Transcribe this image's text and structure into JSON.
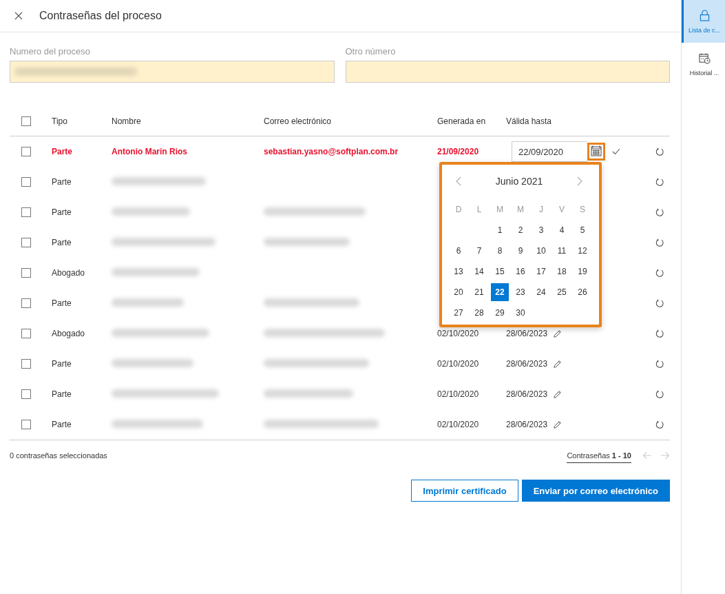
{
  "dialog": {
    "title": "Contraseñas del proceso"
  },
  "fields": [
    {
      "label": "Numero del proceso",
      "blurred": true
    },
    {
      "label": "Otro número",
      "blurred": false
    }
  ],
  "table": {
    "columns": [
      "Tipo",
      "Nombre",
      "Correo electrónico",
      "Generada en",
      "Válida hasta"
    ],
    "all_checked": false,
    "rows": [
      {
        "checked": false,
        "highlighted": true,
        "type": "Parte",
        "name": "Antonio Marin Rios",
        "email": "sebastian.yasno@softplan.com.br",
        "generated": "21/09/2020",
        "valid_until": "22/09/2020",
        "editing": true
      },
      {
        "checked": false,
        "highlighted": false,
        "type": "Parte",
        "name_blurred": true,
        "email_blurred": false
      },
      {
        "checked": false,
        "highlighted": false,
        "type": "Parte",
        "name_blurred": true,
        "email_blurred": true
      },
      {
        "checked": false,
        "highlighted": false,
        "type": "Parte",
        "name_blurred": true,
        "email_blurred": true
      },
      {
        "checked": false,
        "highlighted": false,
        "type": "Abogado",
        "name_blurred": true,
        "email_blurred": false
      },
      {
        "checked": false,
        "highlighted": false,
        "type": "Parte",
        "name_blurred": true,
        "email_blurred": true
      },
      {
        "checked": false,
        "highlighted": false,
        "type": "Abogado",
        "name_blurred": true,
        "email_blurred": true,
        "generated": "02/10/2020",
        "valid_until": "28/06/2023",
        "editing": false
      },
      {
        "checked": false,
        "highlighted": false,
        "type": "Parte",
        "name_blurred": true,
        "email_blurred": true,
        "generated": "02/10/2020",
        "valid_until": "28/06/2023",
        "editing": false
      },
      {
        "checked": false,
        "highlighted": false,
        "type": "Parte",
        "name_blurred": true,
        "email_blurred": true,
        "generated": "02/10/2020",
        "valid_until": "28/06/2023",
        "editing": false
      },
      {
        "checked": false,
        "highlighted": false,
        "type": "Parte",
        "name_blurred": true,
        "email_blurred": true,
        "generated": "02/10/2020",
        "valid_until": "28/06/2023",
        "editing": false
      }
    ]
  },
  "calendar": {
    "month": "Junio 2021",
    "weekdays": [
      "D",
      "L",
      "M",
      "M",
      "J",
      "V",
      "S"
    ],
    "weeks": [
      [
        {
          "kind": "empty"
        },
        {
          "kind": "empty"
        },
        {
          "label": "1",
          "selected": false
        },
        {
          "label": "2",
          "selected": false
        },
        {
          "label": "3",
          "selected": false
        },
        {
          "label": "4",
          "selected": false
        },
        {
          "label": "5",
          "selected": false
        }
      ],
      [
        {
          "label": "6",
          "selected": false
        },
        {
          "label": "7",
          "selected": false
        },
        {
          "label": "8",
          "selected": false
        },
        {
          "label": "9",
          "selected": false
        },
        {
          "label": "10",
          "selected": false
        },
        {
          "label": "11",
          "selected": false
        },
        {
          "label": "12",
          "selected": false
        }
      ],
      [
        {
          "label": "13",
          "selected": false
        },
        {
          "label": "14",
          "selected": false
        },
        {
          "label": "15",
          "selected": false
        },
        {
          "label": "16",
          "selected": false
        },
        {
          "label": "17",
          "selected": false
        },
        {
          "label": "18",
          "selected": false
        },
        {
          "label": "19",
          "selected": false
        }
      ],
      [
        {
          "label": "20",
          "selected": false
        },
        {
          "label": "21",
          "selected": false
        },
        {
          "label": "22",
          "selected": true
        },
        {
          "label": "23",
          "selected": false
        },
        {
          "label": "24",
          "selected": false
        },
        {
          "label": "25",
          "selected": false
        },
        {
          "label": "26",
          "selected": false
        }
      ],
      [
        {
          "label": "27",
          "selected": false
        },
        {
          "label": "28",
          "selected": false
        },
        {
          "label": "29",
          "selected": false
        },
        {
          "label": "30",
          "selected": false
        },
        {
          "kind": "empty"
        },
        {
          "kind": "empty"
        },
        {
          "kind": "empty"
        }
      ]
    ]
  },
  "footer": {
    "selected_count": "0 contraseñas seleccionadas",
    "paging": "Contraseñas **1 - 10**",
    "prev_disabled": true,
    "next_disabled": true
  },
  "buttons": [
    {
      "label": "Imprimir certificado",
      "kind": "secondary"
    },
    {
      "label": "Enviar por correo electrónico",
      "kind": "primary"
    }
  ],
  "sidebar": {
    "items": [
      {
        "label": "Lista de c...",
        "selected": true
      },
      {
        "label": "Historial ...",
        "selected": false
      }
    ]
  }
}
